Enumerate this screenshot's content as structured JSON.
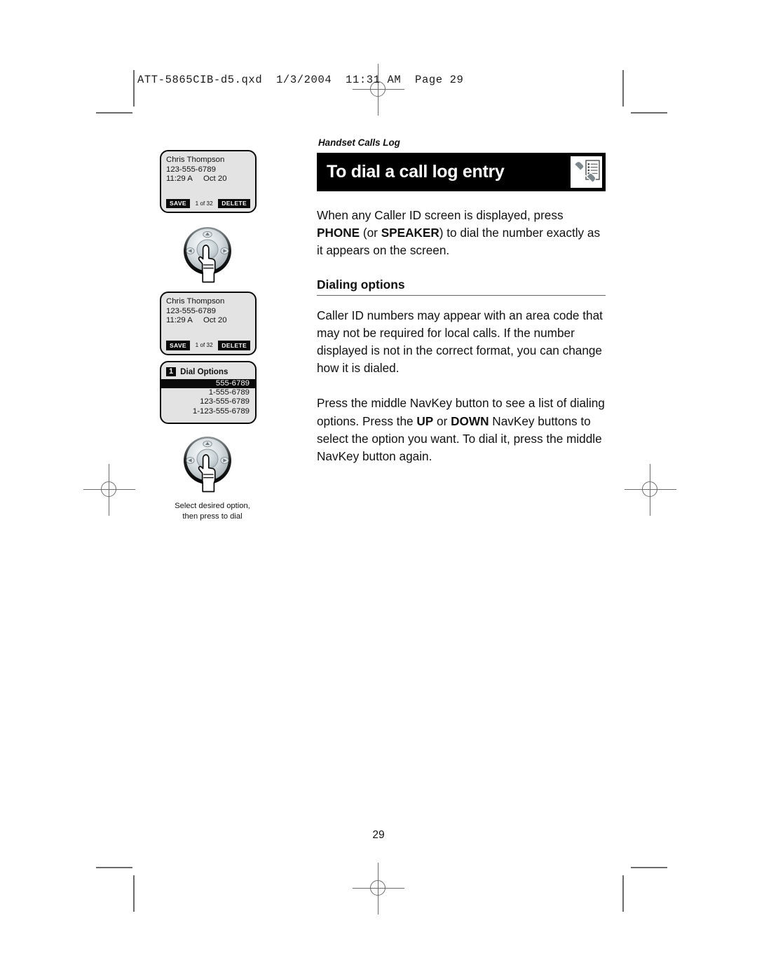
{
  "print_slug": "ATT-5865CIB-d5.qxd  1/3/2004  11:31 AM  Page 29",
  "page_number": "29",
  "main": {
    "eyebrow": "Handset Calls Log",
    "title": "To dial a call log entry",
    "title_icon": "phone-list-icon",
    "paragraph_1": {
      "part_1": "When any Caller ID screen is displayed, press ",
      "bold_1": "PHONE",
      "part_2": " (or ",
      "bold_2": "SPEAKER",
      "part_3": ") to dial the number exactly as it appears on the screen."
    },
    "subhead": "Dialing options",
    "paragraph_2": "Caller ID numbers may appear with an area code that may not be required for local calls. If the number displayed is not in the correct format, you can change how it is dialed.",
    "paragraph_3": {
      "part_1": "Press the middle NavKey button to see a list of dialing options. Press the ",
      "bold_1": "UP",
      "part_2": " or ",
      "bold_2": "DOWN",
      "part_3": " NavKey buttons to select the option you want. To dial it, press the middle NavKey button again."
    }
  },
  "illustrations": {
    "caller_id_screen_1": {
      "name": "Chris Thompson",
      "number": "123-555-6789",
      "time_date": "11:29 A     Oct 20",
      "softkey_left": "SAVE",
      "counter": "1 of 32",
      "softkey_right": "DELETE"
    },
    "caller_id_screen_2": {
      "name": "Chris Thompson",
      "number": "123-555-6789",
      "time_date": "11:29 A     Oct 20",
      "softkey_left": "SAVE",
      "counter": "1 of 32",
      "softkey_right": "DELETE"
    },
    "dial_options_screen": {
      "badge": "1",
      "title": "Dial Options",
      "options": [
        "555-6789",
        "1-555-6789",
        "123-555-6789",
        "1-123-555-6789"
      ],
      "selected_index": 0
    },
    "navkey_1": "navkey-press-icon",
    "navkey_2": "navkey-press-icon",
    "caption": "Select desired option,\nthen press to dial"
  }
}
